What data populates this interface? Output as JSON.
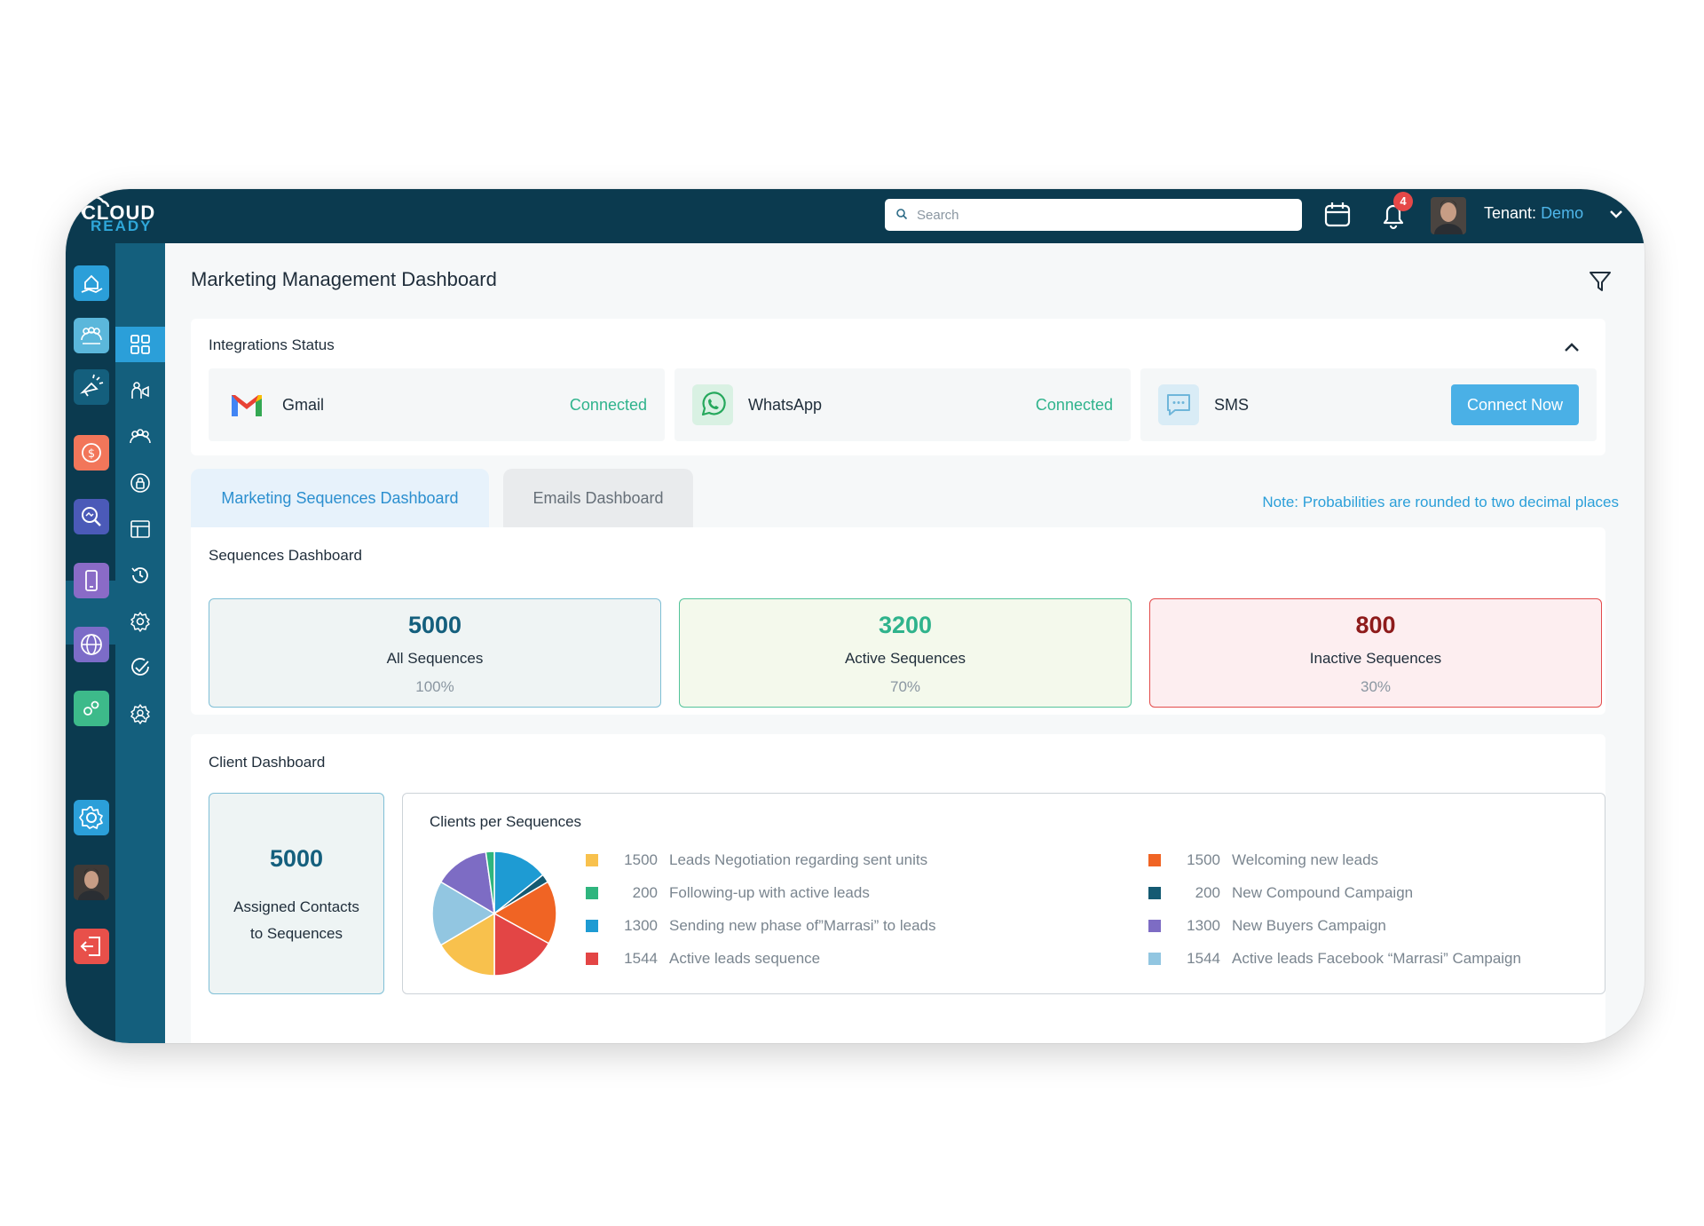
{
  "header": {
    "logo_line1": "CLOUD",
    "logo_line2": "READY",
    "search_placeholder": "Search",
    "notification_count": "4",
    "tenant_label": "Tenant:",
    "tenant_value": "Demo"
  },
  "sidebar": {
    "modules": [
      {
        "icon": "home-hand-icon",
        "color": "#2b9fd9"
      },
      {
        "icon": "team-icon",
        "color": "#5bb7db"
      },
      {
        "icon": "megaphone-icon",
        "color": "#145f7d"
      },
      {
        "icon": "dollar-cycle-icon",
        "color": "#f2765a"
      },
      {
        "icon": "search-analytics-icon",
        "color": "#4b5ab8"
      },
      {
        "icon": "mobile-icon",
        "color": "#8a6bc7"
      },
      {
        "icon": "globe-icon",
        "color": "#7c6cc8"
      },
      {
        "icon": "gears-icon",
        "color": "#3dba8a"
      },
      {
        "icon": "settings-icon",
        "color": "#2b9fd9"
      },
      {
        "icon": "logout-icon",
        "color": "#e8504a"
      }
    ],
    "submenu": [
      "grid-icon",
      "campaign-person-icon",
      "group-icon",
      "lock-cycle-icon",
      "table-icon",
      "history-icon",
      "gear-icon",
      "check-circle-icon",
      "gear-people-icon"
    ]
  },
  "page": {
    "title": "Marketing Management Dashboard"
  },
  "integrations": {
    "title": "Integrations Status",
    "items": [
      {
        "name": "Gmail",
        "status": "Connected"
      },
      {
        "name": "WhatsApp",
        "status": "Connected"
      },
      {
        "name": "SMS",
        "action": "Connect Now"
      }
    ]
  },
  "tabs": {
    "active": "Marketing Sequences Dashboard",
    "inactive": "Emails Dashboard",
    "note": "Note: Probabilities are rounded to two decimal places"
  },
  "sequences": {
    "title": "Sequences Dashboard",
    "boxes": [
      {
        "value": "5000",
        "label": "All Sequences",
        "percent": "100%"
      },
      {
        "value": "3200",
        "label": "Active Sequences",
        "percent": "70%"
      },
      {
        "value": "800",
        "label": "Inactive Sequences",
        "percent": "30%"
      }
    ]
  },
  "client": {
    "title": "Client Dashboard",
    "assigned_value": "5000",
    "assigned_line1": "Assigned Contacts",
    "assigned_line2": "to Sequences",
    "pie_title": "Clients per Sequences"
  },
  "chart_data": {
    "type": "pie",
    "title": "Clients per Sequences",
    "categories": [
      "Leads Negotiation regarding sent units",
      "Following-up with active leads",
      "Sending new phase of”Marrasi” to leads",
      "Active leads sequence",
      "Welcoming new leads",
      "New Compound Campaign",
      "New Buyers Campaign",
      "Active leads Facebook “Marrasi” Campaign"
    ],
    "values": [
      1500,
      200,
      1300,
      1544,
      1500,
      200,
      1300,
      1544
    ],
    "colors": [
      "#f8c14d",
      "#2fb57e",
      "#1e9bd3",
      "#e34545",
      "#f06424",
      "#145a72",
      "#7d6cc4",
      "#92c6e1"
    ],
    "legend": "right"
  }
}
